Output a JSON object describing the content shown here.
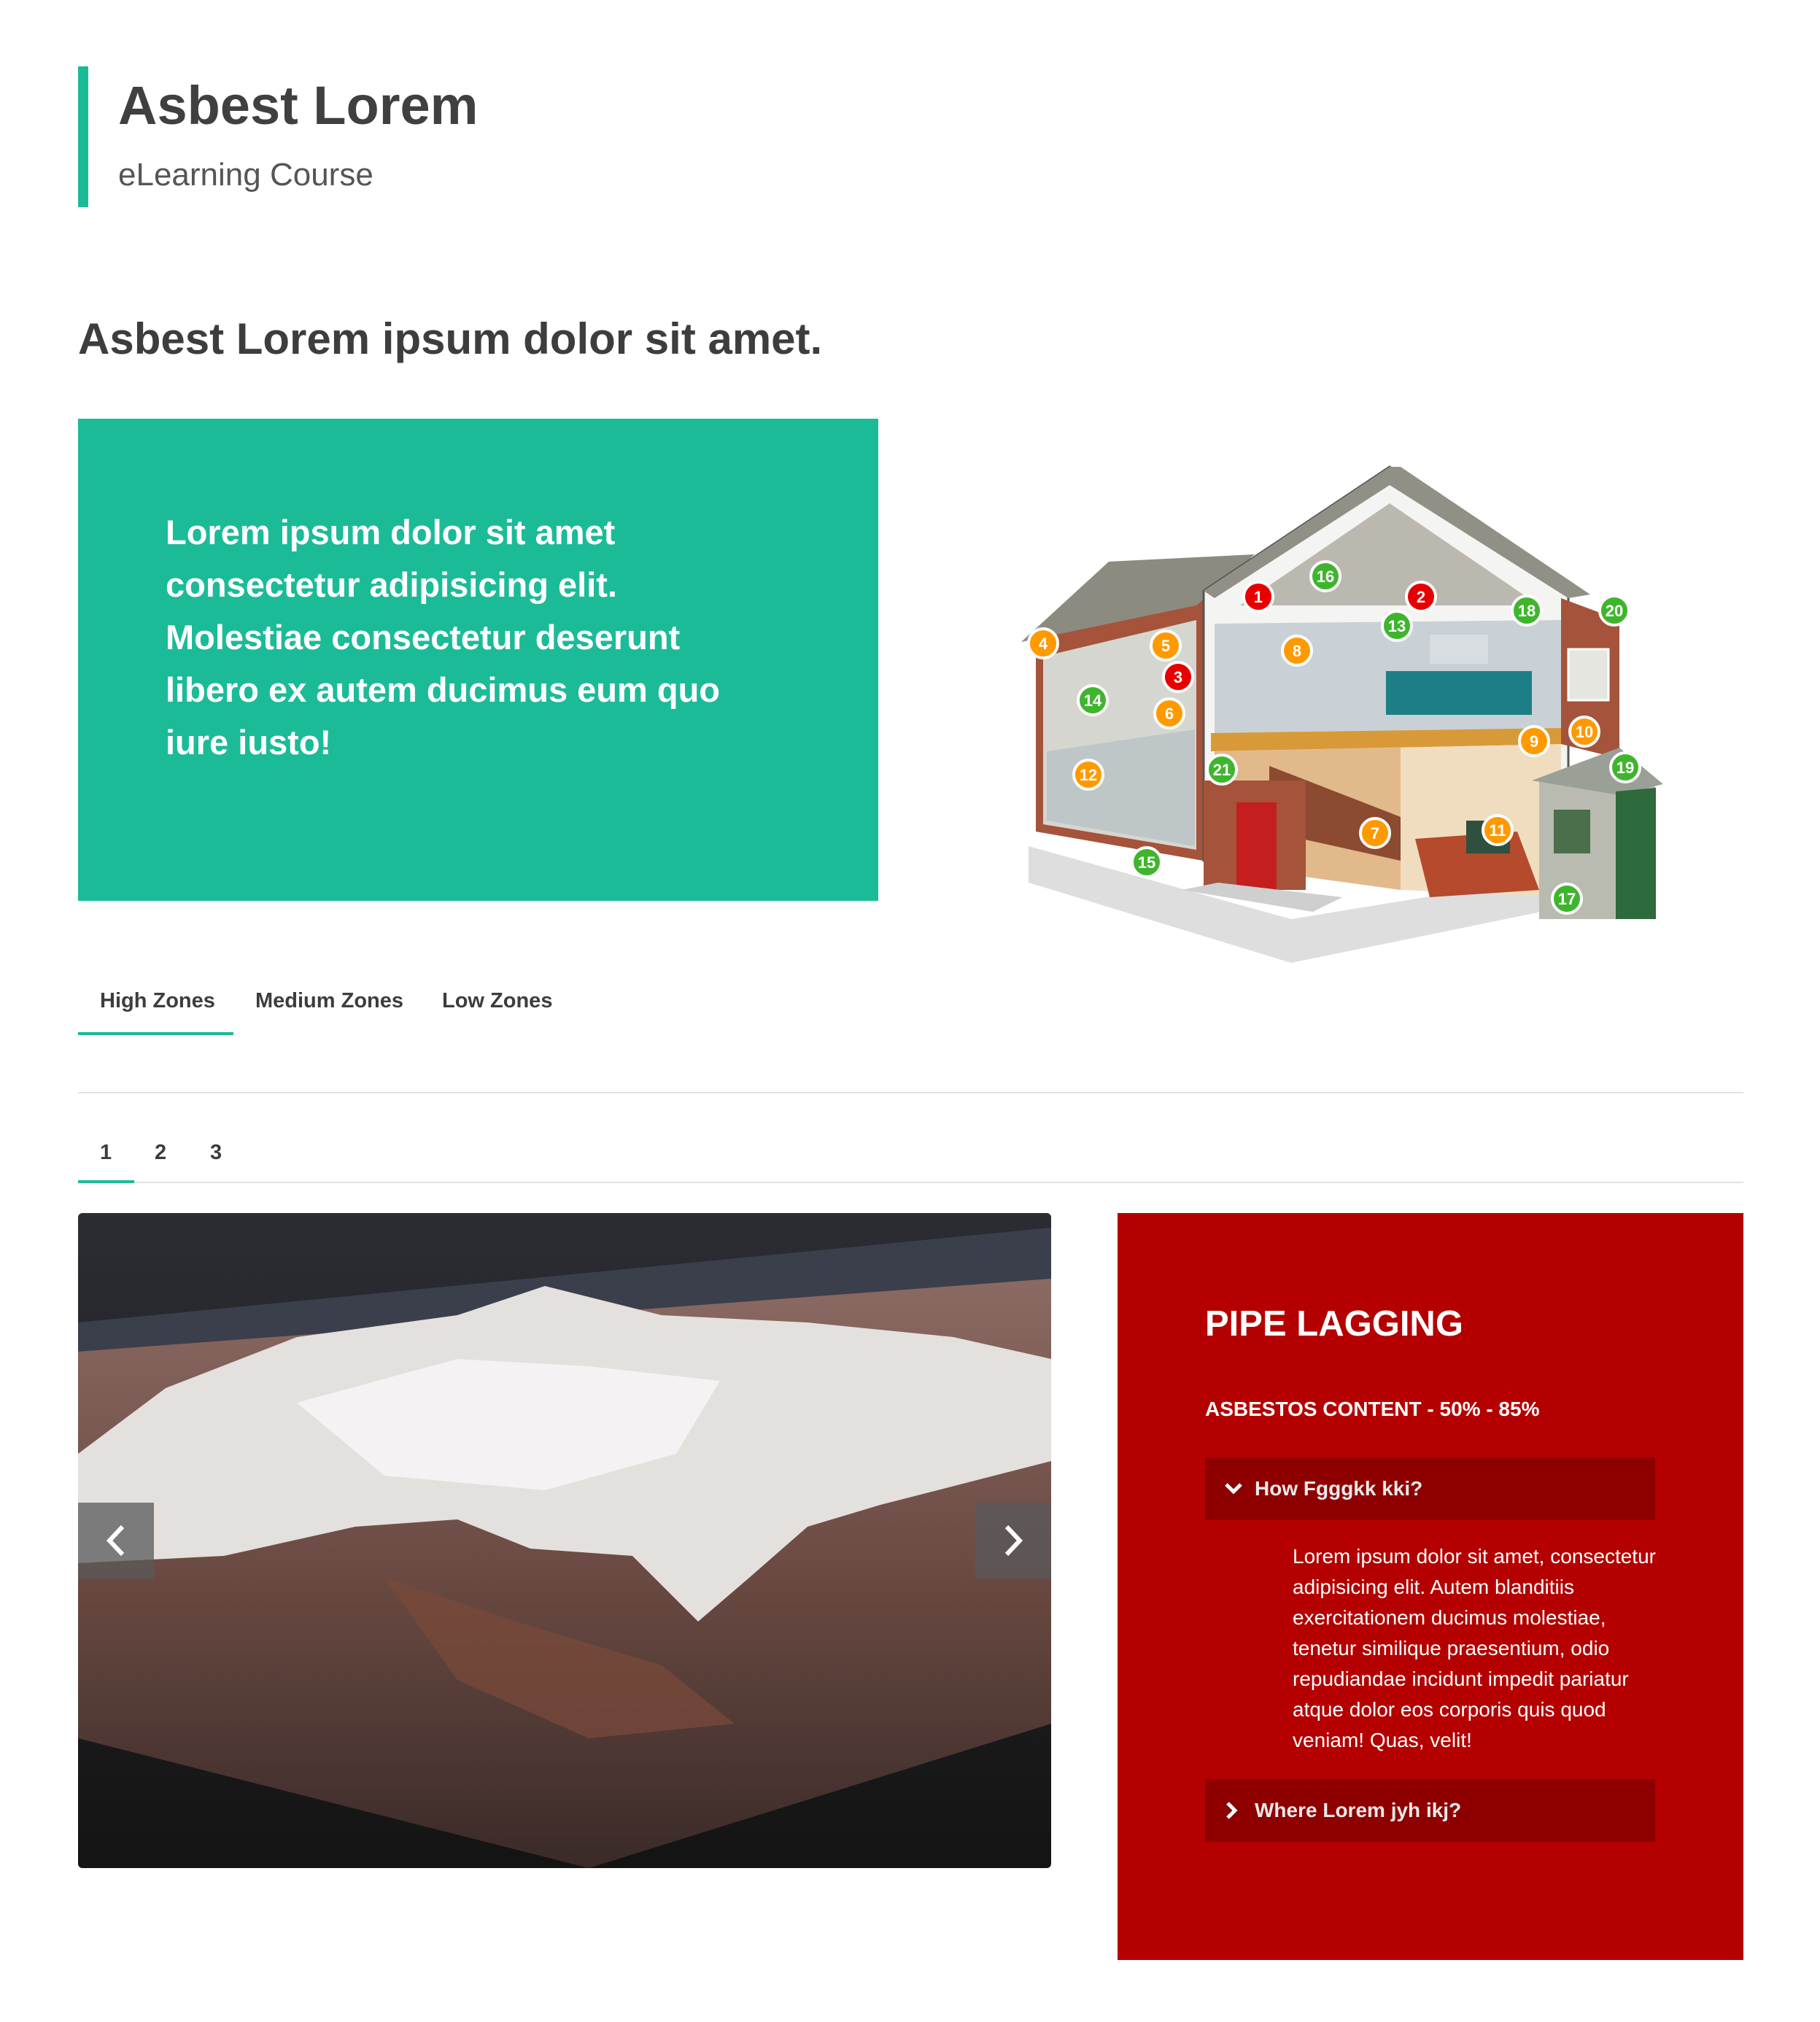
{
  "header": {
    "title": "Asbest Lorem",
    "subtitle": "eLearning Course"
  },
  "page_title": "Asbest Lorem ipsum dolor sit amet.",
  "intro": {
    "text": "Lorem ipsum dolor sit amet consectetur adipisicing elit. Molestiae consectetur deserunt libero ex autem ducimus eum quo iure iusto!"
  },
  "house": {
    "hotspots": [
      {
        "n": "1",
        "level": "high"
      },
      {
        "n": "2",
        "level": "high"
      },
      {
        "n": "3",
        "level": "high"
      },
      {
        "n": "4",
        "level": "medium"
      },
      {
        "n": "5",
        "level": "medium"
      },
      {
        "n": "6",
        "level": "medium"
      },
      {
        "n": "7",
        "level": "medium"
      },
      {
        "n": "8",
        "level": "medium"
      },
      {
        "n": "9",
        "level": "medium"
      },
      {
        "n": "10",
        "level": "medium"
      },
      {
        "n": "11",
        "level": "medium"
      },
      {
        "n": "12",
        "level": "medium"
      },
      {
        "n": "13",
        "level": "low"
      },
      {
        "n": "14",
        "level": "low"
      },
      {
        "n": "15",
        "level": "low"
      },
      {
        "n": "16",
        "level": "low"
      },
      {
        "n": "17",
        "level": "low"
      },
      {
        "n": "18",
        "level": "low"
      },
      {
        "n": "19",
        "level": "low"
      },
      {
        "n": "20",
        "level": "low"
      },
      {
        "n": "21",
        "level": "low"
      }
    ]
  },
  "zone_tabs": {
    "items": [
      "High Zones",
      "Medium Zones",
      "Low Zones"
    ],
    "active": "High Zones"
  },
  "page_tabs": {
    "items": [
      "1",
      "2",
      "3"
    ],
    "active": "1"
  },
  "info": {
    "title": "PIPE LAGGING",
    "content": "ASBESTOS CONTENT - 50% - 85%",
    "accordion": [
      {
        "label": "How Fgggkk kki?",
        "open": true,
        "body": "Lorem ipsum dolor sit amet, consectetur adipisicing elit. Autem blanditiis exercitationem ducimus molestiae, tenetur similique praesentium, odio repudiandae incidunt impedit pariatur atque dolor eos corporis quis quod veniam! Quas, velit!"
      },
      {
        "label": "Where Lorem jyh ikj?",
        "open": false
      }
    ]
  },
  "colors": {
    "accent": "#1cbb98",
    "danger_panel": "#b40000",
    "accordion_header": "#8e0000",
    "hotspot_high": "#e60000",
    "hotspot_medium": "#ff9900",
    "hotspot_low": "#3fb52e"
  },
  "icons": {
    "carousel_prev": "chevron-left-icon",
    "carousel_next": "chevron-right-icon",
    "accordion_open": "chevron-down-icon",
    "accordion_closed": "chevron-right-icon"
  }
}
